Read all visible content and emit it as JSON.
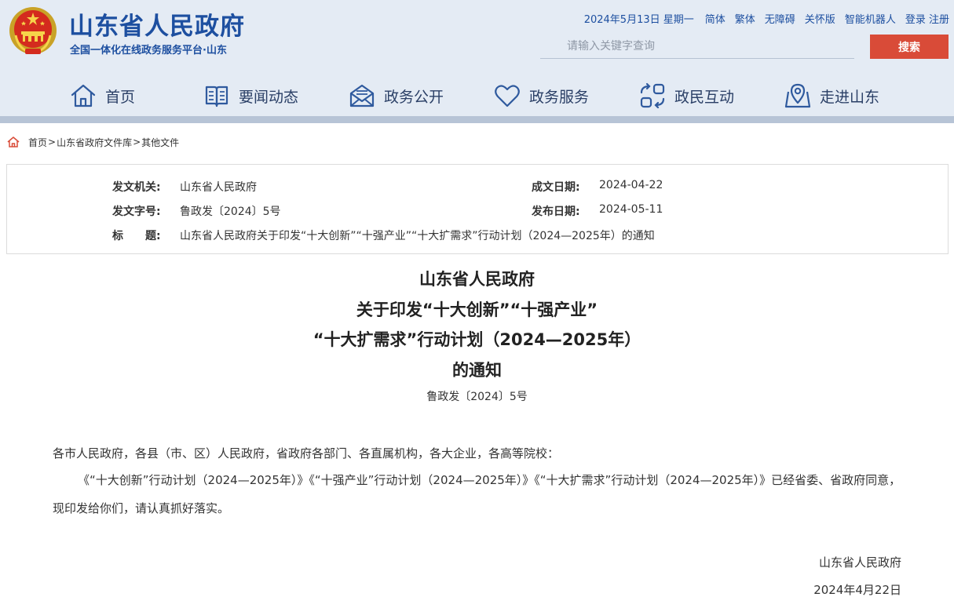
{
  "header": {
    "site_title": "山东省人民政府",
    "site_subtitle": "全国一体化在线政务服务平台·山东",
    "date_text": "2024年5月13日 星期一",
    "top_links": [
      "简体",
      "繁体",
      "无障碍",
      "关怀版",
      "智能机器人"
    ],
    "login": "登录",
    "register": "注册",
    "search_placeholder": "请输入关键字查询",
    "search_button": "搜索",
    "colors": {
      "brand": "#1d4fa0",
      "search_button": "#d94b38",
      "header_bg": "#e4ebf4"
    }
  },
  "nav": [
    {
      "label": "首页",
      "icon": "home-icon"
    },
    {
      "label": "要闻动态",
      "icon": "book-icon"
    },
    {
      "label": "政务公开",
      "icon": "mail-icon"
    },
    {
      "label": "政务服务",
      "icon": "heart-icon"
    },
    {
      "label": "政民互动",
      "icon": "interaction-icon"
    },
    {
      "label": "走进山东",
      "icon": "map-pin-icon"
    }
  ],
  "breadcrumb": [
    "首页",
    "山东省政府文件库",
    "其他文件"
  ],
  "meta": {
    "issuer_label": "发文机关:",
    "issuer": "山东省人民政府",
    "doc_no_label": "发文字号:",
    "doc_no": "鲁政发〔2024〕5号",
    "title_label": "标　　题:",
    "title": "山东省人民政府关于印发“十大创新”“十强产业”“十大扩需求”行动计划（2024—2025年）的通知",
    "written_label": "成文日期:",
    "written_date": "2024-04-22",
    "published_label": "发布日期:",
    "published_date": "2024-05-11"
  },
  "document": {
    "title_lines": [
      "山东省人民政府",
      "关于印发“十大创新”“十强产业”",
      "“十大扩需求”行动计划（2024—2025年）",
      "的通知"
    ],
    "doc_number": "鲁政发〔2024〕5号",
    "salutation": "各市人民政府，各县（市、区）人民政府，省政府各部门、各直属机构，各大企业，各高等院校：",
    "body": "《“十大创新”行动计划（2024—2025年）》《“十强产业”行动计划（2024—2025年）》《“十大扩需求”行动计划（2024—2025年）》已经省委、省政府同意，现印发给你们，请认真抓好落实。",
    "signature_org": "山东省人民政府",
    "signature_date": "2024年4月22日"
  }
}
